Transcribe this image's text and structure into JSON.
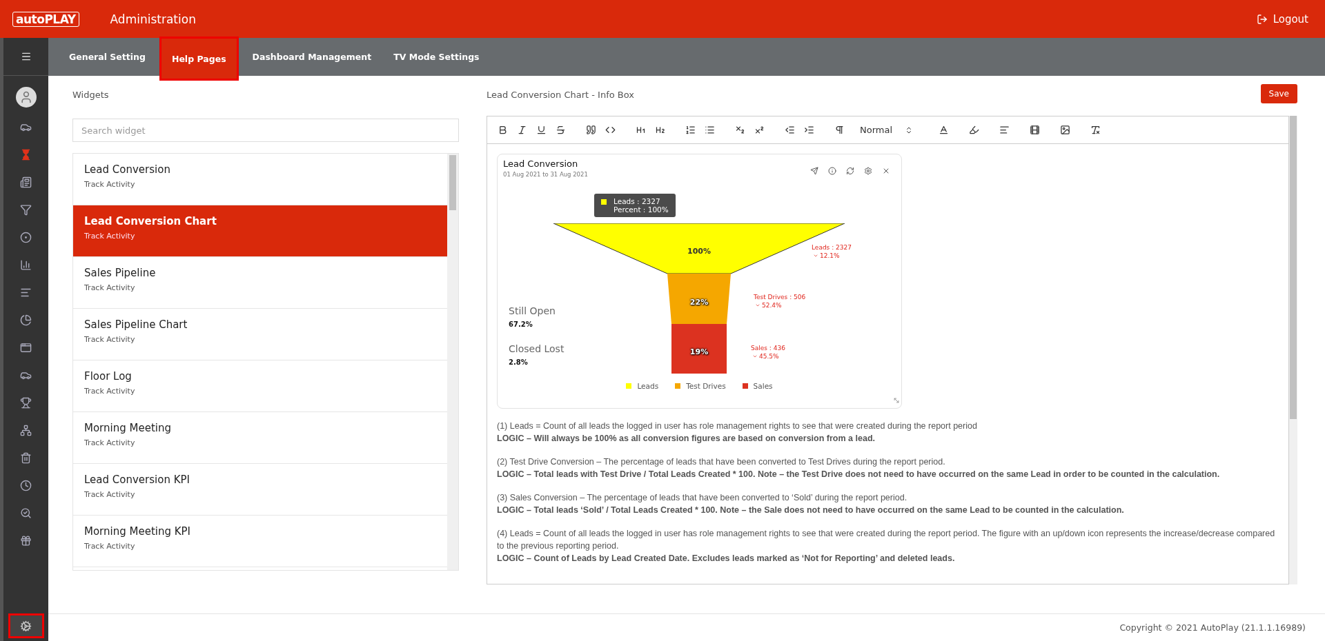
{
  "header": {
    "brand": "autoPLAY",
    "title": "Administration",
    "logout": "Logout"
  },
  "tabs": [
    {
      "label": "General Setting",
      "selected": false,
      "highlighted": false
    },
    {
      "label": "Help Pages",
      "selected": true,
      "highlighted": true
    },
    {
      "label": "Dashboard Management",
      "selected": false,
      "highlighted": false
    },
    {
      "label": "TV Mode Settings",
      "selected": false,
      "highlighted": false
    }
  ],
  "sidebar": {
    "items": [
      {
        "selected": false
      },
      {
        "selected": true
      },
      {
        "selected": false
      },
      {
        "selected": false
      },
      {
        "selected": false
      },
      {
        "selected": false
      },
      {
        "selected": false
      },
      {
        "selected": false
      },
      {
        "selected": false
      },
      {
        "selected": false
      },
      {
        "selected": false
      },
      {
        "selected": false
      },
      {
        "selected": false
      },
      {
        "selected": false
      },
      {
        "selected": false
      },
      {
        "selected": false
      }
    ],
    "settings": {
      "highlighted": true
    }
  },
  "widgets": {
    "heading": "Widgets",
    "search": {
      "placeholder": "Search widget"
    },
    "items": [
      {
        "name": "Lead Conversion",
        "subtitle": "Track Activity",
        "selected": false
      },
      {
        "name": "Lead Conversion Chart",
        "subtitle": "Track Activity",
        "selected": true
      },
      {
        "name": "Sales Pipeline",
        "subtitle": "Track Activity",
        "selected": false
      },
      {
        "name": "Sales Pipeline Chart",
        "subtitle": "Track Activity",
        "selected": false
      },
      {
        "name": "Floor Log",
        "subtitle": "Track Activity",
        "selected": false
      },
      {
        "name": "Morning Meeting",
        "subtitle": "Track Activity",
        "selected": false
      },
      {
        "name": "Lead Conversion KPI",
        "subtitle": "Track Activity",
        "selected": false
      },
      {
        "name": "Morning Meeting KPI",
        "subtitle": "Track Activity",
        "selected": false
      }
    ]
  },
  "editor": {
    "title": "Lead Conversion Chart - Info Box",
    "save": "Save",
    "format": "Normal",
    "card": {
      "title": "Lead Conversion",
      "period": "01 Aug 2021 to 31 Aug 2021",
      "tooltip": {
        "color": "#ffff00",
        "line_1": "Leads : 2327",
        "line_2": "Percent :  100%"
      },
      "stats": [
        {
          "label": "Still Open",
          "value": "67.2%"
        },
        {
          "label": "Closed Lost",
          "value": "2.8%"
        }
      ],
      "stages": [
        {
          "name": "Leads",
          "percent": "100%",
          "callout": "Leads : 2327",
          "change": "12.1%",
          "color": "#ffff00"
        },
        {
          "name": "Test Drives",
          "percent": "22%",
          "callout": "Test Drives : 506",
          "change": "52.4%",
          "color": "#f5a700"
        },
        {
          "name": "Sales",
          "percent": "19%",
          "callout": "Sales : 436",
          "change": "45.5%",
          "color": "#dc3220"
        }
      ]
    },
    "paragraphs": [
      {
        "text": "(1)  Leads = Count of all leads the logged in user has role management rights to see that were created during the report period",
        "logic": "LOGIC – Will always be 100% as all conversion figures are based on conversion from a lead."
      },
      {
        "text": "(2) Test Drive Conversion – The percentage of leads that have been converted to Test Drives during the report period.",
        "logic": "LOGIC – Total leads with Test Drive / Total Leads Created * 100. Note – the Test Drive does not need to have occurred on the same Lead in order to be counted in the calculation."
      },
      {
        "text": "(3) Sales Conversion – The percentage of leads that have been converted to ‘Sold’ during the report period.",
        "logic": "LOGIC – Total leads ‘Sold’ / Total Leads Created * 100. Note – the Sale does not need to have occurred on the same Lead to be counted in the calculation."
      },
      {
        "text": "(4) Leads = Count of all leads the logged in user has role management rights to see that were created during the report period. The figure with an up/down icon represents the increase/decrease compared to the previous reporting period.",
        "logic": "LOGIC – Count of Leads by Lead Created Date. Excludes leads marked as ‘Not for Reporting’ and deleted leads."
      }
    ]
  },
  "footer": {
    "copyright": "Copyright © 2021 AutoPlay (21.1.1.16989)"
  }
}
